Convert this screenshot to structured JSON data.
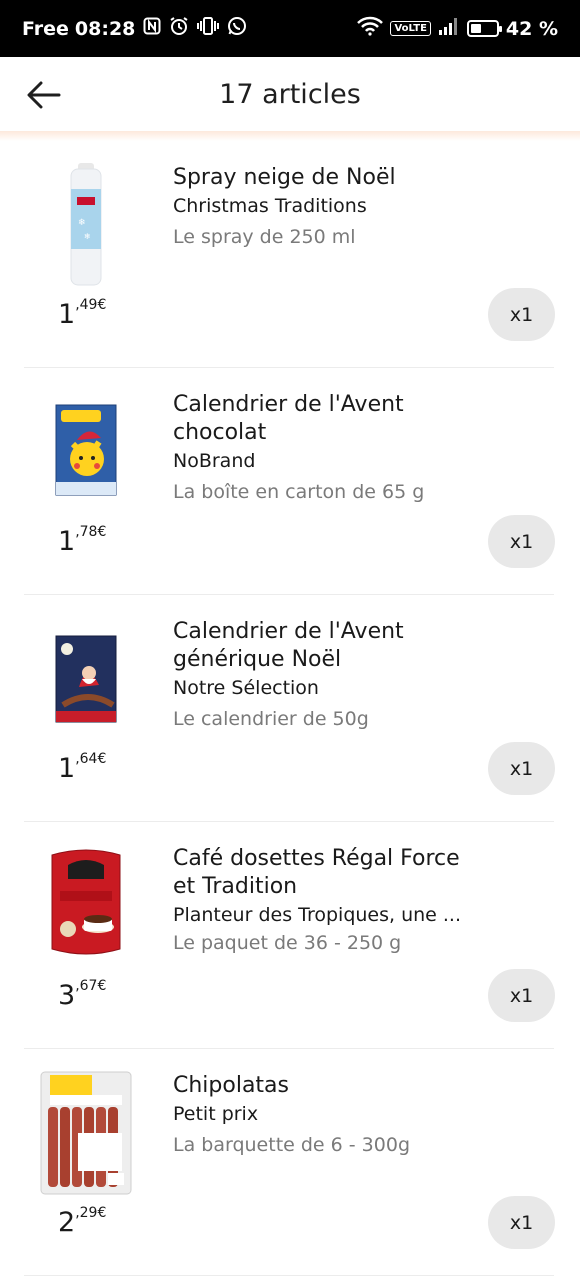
{
  "status_bar": {
    "carrier": "Free",
    "time": "08:28",
    "volte": "VoLTE",
    "battery": "42 %",
    "battery_level": 0.42
  },
  "header": {
    "title": "17 articles"
  },
  "items": [
    {
      "name": "Spray neige de Noël",
      "brand": "Christmas Traditions",
      "size": "Le spray de 250 ml",
      "price_int": "1",
      "price_cents": ",49€",
      "qty": "x1"
    },
    {
      "name": "Calendrier de l'Avent chocolat",
      "brand": "NoBrand",
      "size": "La boîte en carton de 65 g",
      "price_int": "1",
      "price_cents": ",78€",
      "qty": "x1"
    },
    {
      "name": "Calendrier de l'Avent générique Noël",
      "brand": "Notre Sélection",
      "size": "Le calendrier de 50g",
      "price_int": "1",
      "price_cents": ",64€",
      "qty": "x1"
    },
    {
      "name": "Café dosettes Régal Force et Tradition",
      "brand": "Planteur des Tropiques, une ...",
      "size": "Le paquet de 36 - 250 g",
      "price_int": "3",
      "price_cents": ",67€",
      "qty": "x1"
    },
    {
      "name": "Chipolatas",
      "brand": "Petit prix",
      "size": "La barquette de 6 - 300g",
      "price_int": "2",
      "price_cents": ",29€",
      "qty": "x1"
    }
  ],
  "icons": {
    "back": "arrow-left-icon",
    "nfc": "nfc-icon",
    "alarm": "alarm-icon",
    "vibrate": "vibrate-icon",
    "whatsapp": "whatsapp-icon",
    "wifi": "wifi-icon",
    "signal": "signal-icon",
    "battery": "battery-icon"
  },
  "colors": {
    "qty_bg": "#e8e8e8",
    "size_text": "#7a7a7a",
    "header_shadow": "#fde9dc"
  }
}
